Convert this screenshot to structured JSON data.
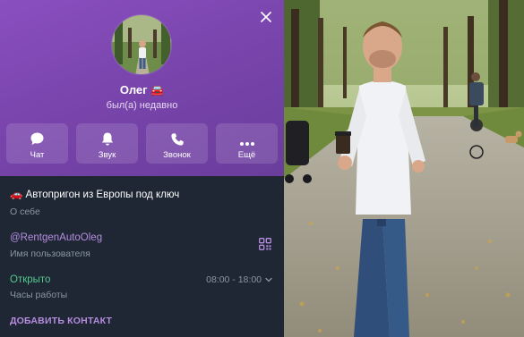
{
  "profile": {
    "name": "Олег",
    "name_emoji": "🚘",
    "status": "был(а) недавно"
  },
  "actions": [
    {
      "label": "Чат",
      "icon": "chat-icon"
    },
    {
      "label": "Звук",
      "icon": "bell-icon"
    },
    {
      "label": "Звонок",
      "icon": "phone-icon"
    },
    {
      "label": "Ещё",
      "icon": "more-icon"
    }
  ],
  "info": {
    "bio_emoji": "🚗",
    "bio": "Автопригон из Европы под ключ",
    "bio_caption": "О себе",
    "username": "@RentgenAutoOleg",
    "username_caption": "Имя пользователя",
    "open_status": "Открыто",
    "hours": "08:00 - 18:00",
    "hours_caption": "Часы работы",
    "add_contact": "ДОБАВИТЬ КОНТАКТ"
  },
  "colors": {
    "header_gradient_start": "#8a4fbf",
    "header_gradient_end": "#6a3d9c",
    "panel_bg": "#1e2733",
    "accent": "#b68de0",
    "open_green": "#54c88e",
    "muted": "#8a96a3"
  }
}
